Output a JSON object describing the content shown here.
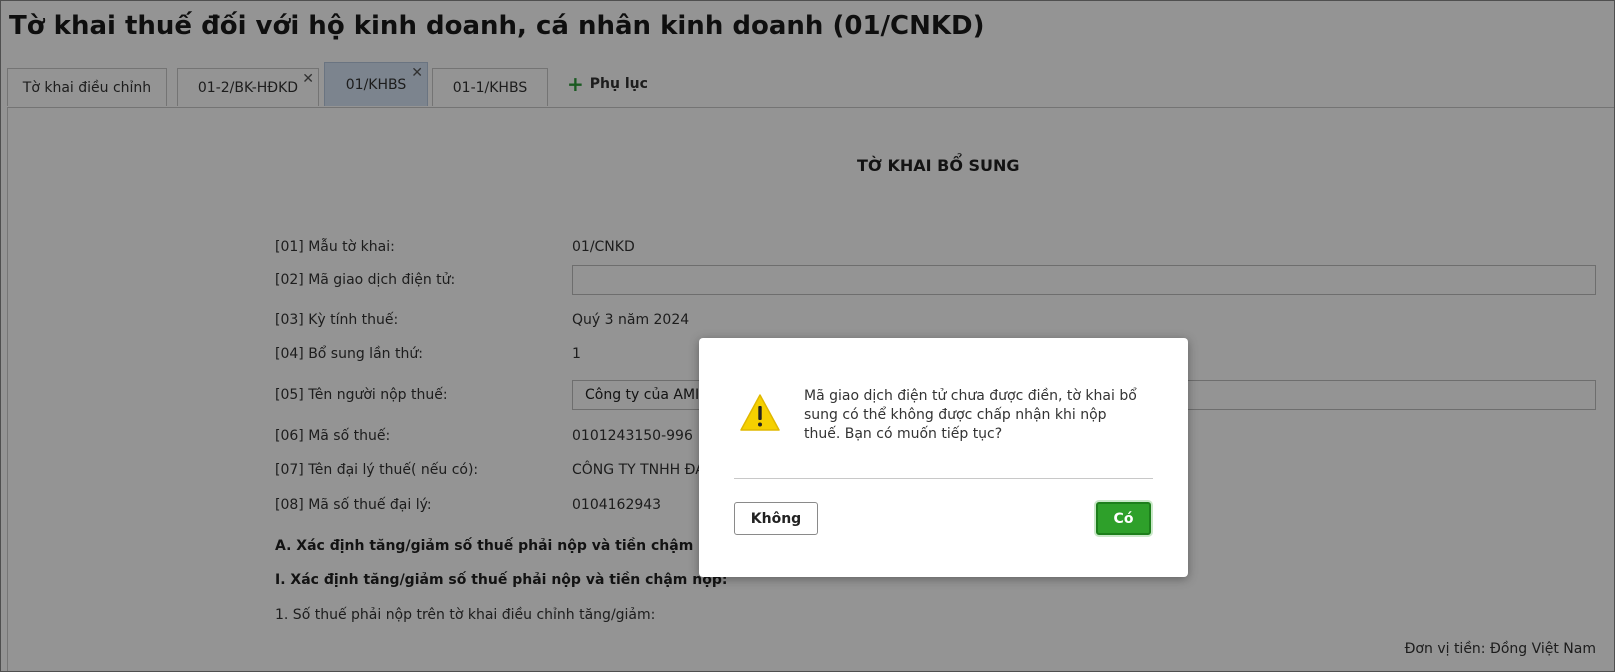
{
  "page_title": "Tờ khai thuế đối với hộ kinh doanh, cá nhân kinh doanh (01/CNKD)",
  "tabs": [
    {
      "label": "Tờ khai điều chỉnh",
      "closable": false
    },
    {
      "label": "01-2/BK-HĐKD",
      "closable": true
    },
    {
      "label": "01/KHBS",
      "closable": true,
      "active": true
    },
    {
      "label": "01-1/KHBS",
      "closable": false
    }
  ],
  "tab_close_symbol": "✕",
  "add_tab": {
    "icon": "plus-icon",
    "symbol": "+",
    "label": "Phụ lục"
  },
  "form": {
    "title": "TỜ KHAI BỔ SUNG",
    "rows": [
      {
        "label": "[01] Mẫu tờ khai:",
        "value": "01/CNKD"
      },
      {
        "label": "[02] Mã giao dịch điện tử:",
        "value": ""
      },
      {
        "label": "[03] Kỳ tính thuế:",
        "value": "Quý 3 năm 2024"
      },
      {
        "label": "[04] Bổ sung lần thứ:",
        "value": "1"
      },
      {
        "label": "[05] Tên người nộp thuế:",
        "value": "Công ty của AMIS"
      },
      {
        "label": "[06] Mã số thuế:",
        "value": "0101243150-996"
      },
      {
        "label": "[07] Tên đại lý thuế( nếu có):",
        "value": "CÔNG TY TNHH ĐA"
      },
      {
        "label": "[08] Mã số thuế đại lý:",
        "value": "0104162943"
      }
    ],
    "section_a": "A. Xác định tăng/giảm số thuế phải nộp và tiền chậm nộp, tă",
    "section_i": "I. Xác định tăng/giảm số thuế phải nộp và tiền chậm nộp:",
    "item_1": "1. Số thuế phải nộp trên tờ khai điều chỉnh tăng/giảm:",
    "currency_unit": "Đơn vị tiền: Đồng Việt Nam"
  },
  "dialog": {
    "icon": "warning-icon",
    "icon_color": "#f5d000",
    "message": "Mã giao dịch điện tử chưa được điền, tờ khai bổ sung có thể không được chấp nhận khi nộp thuế. Bạn có muốn tiếp tục?",
    "no_label": "Không",
    "yes_label": "Có",
    "yes_color": "#2ea02a"
  }
}
